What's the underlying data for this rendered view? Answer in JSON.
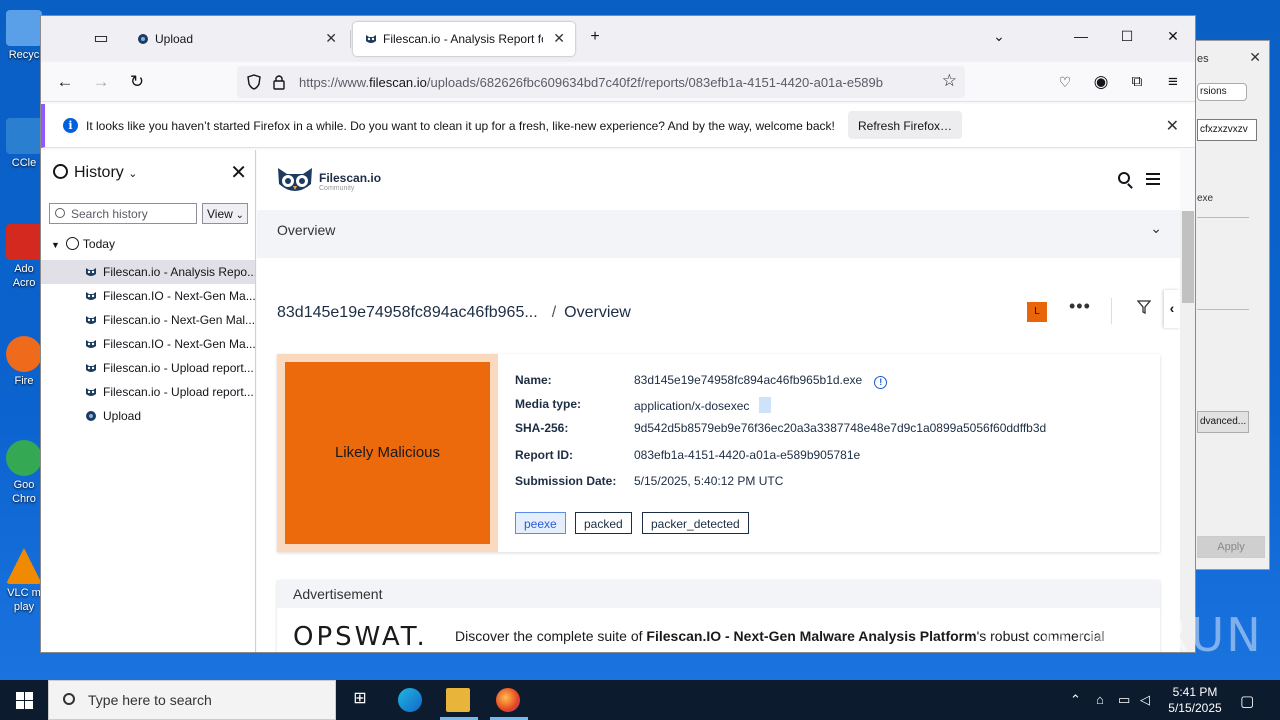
{
  "desktop": {
    "icons": [
      {
        "label": "Recyc",
        "color": "#5aa0e8"
      },
      {
        "label": "CCle",
        "color": "#2b7fd1"
      },
      {
        "label": "Ado Acro",
        "color": "#d4291f"
      },
      {
        "label": "Fire",
        "color": "#f06a1b"
      },
      {
        "label": "Goo Chro",
        "color": "#34a853"
      },
      {
        "label": "VLC m play",
        "color": "#f08a00"
      }
    ]
  },
  "bg_dialog": {
    "title_fragment": "es",
    "tab_fragment": "rsions",
    "input_fragment": "cfxzxzvxzv",
    "label_fragment": "exe",
    "button_fragment": "dvanced...",
    "apply_label": "Apply"
  },
  "browser": {
    "tabs": [
      {
        "label": "Upload",
        "active": false
      },
      {
        "label": "Filescan.io - Analysis Report for",
        "active": true
      }
    ],
    "url_host_prefix": "https://www.",
    "url_host": "filescan.io",
    "url_path": "/uploads/682626fbc609634bd7c40f2f/reports/083efb1a-4151-4420-a01a-e589b",
    "notification": {
      "message": "It looks like you haven’t started Firefox in a while. Do you want to clean it up for a fresh, like-new experience? And by the way, welcome back!",
      "button": "Refresh Firefox…"
    }
  },
  "sidebar": {
    "title": "History",
    "search_placeholder": "Search history",
    "view_label": "View",
    "group_label": "Today",
    "items": [
      {
        "label": "Filescan.io - Analysis Repo...",
        "selected": true
      },
      {
        "label": "Filescan.IO - Next-Gen Ma..."
      },
      {
        "label": "Filescan.io - Next-Gen Mal..."
      },
      {
        "label": "Filescan.IO - Next-Gen Ma..."
      },
      {
        "label": "Filescan.io - Upload report..."
      },
      {
        "label": "Filescan.io - Upload report..."
      },
      {
        "label": "Upload"
      }
    ]
  },
  "page": {
    "logo_title": "Filescan.io",
    "logo_sub": "Community",
    "overview_bar": "Overview",
    "crumb_hash": "83d145e19e74958fc894ac46fb965...",
    "crumb_sep": "/",
    "crumb_page": "Overview",
    "badge_letter": "L",
    "verdict": "Likely Malicious",
    "fields": [
      {
        "key": "Name:",
        "value": "83d145e19e74958fc894ac46fb965b1d.exe"
      },
      {
        "key": "Media type:",
        "value": "application/x-dosexec"
      },
      {
        "key": "SHA-256:",
        "value": "9d542d5b8579eb9e76f36ec20a3a3387748e48e7d9c1a0899a5056f60ddffb3d"
      },
      {
        "key": "Report ID:",
        "value": "083efb1a-4151-4420-a01a-e589b905781e"
      },
      {
        "key": "Submission Date:",
        "value": "5/15/2025, 5:40:12 PM UTC"
      }
    ],
    "tags": [
      "peexe",
      "packed",
      "packer_detected"
    ],
    "ad_header": "Advertisement",
    "ad_logo": "OPSWAT.",
    "ad_text_pre": "Discover the complete suite of ",
    "ad_text_bold": "Filescan.IO - Next-Gen Malware Analysis Platform",
    "ad_text_post": "'s robust commercial"
  },
  "watermark": "ANY RUN",
  "taskbar": {
    "search_placeholder": "Type here to search",
    "time": "5:41 PM",
    "date": "5/15/2025"
  },
  "colors": {
    "verdict": "#ed6a0c",
    "verdict_frame": "#fbd9bf",
    "accent": "#9059ff"
  }
}
